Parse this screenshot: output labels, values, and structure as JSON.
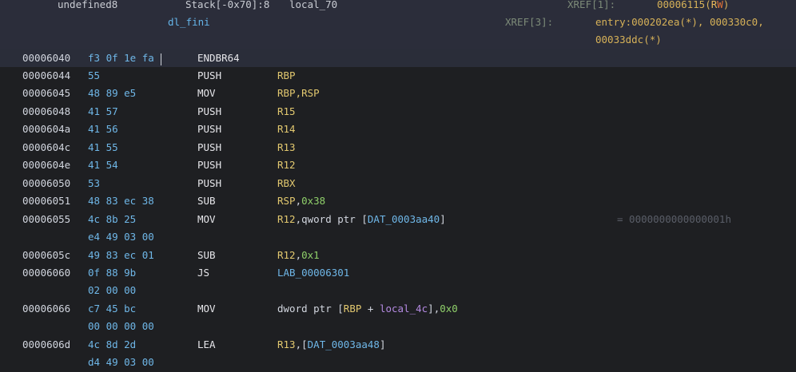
{
  "header": {
    "var_type": "undefined8",
    "var_storage": "Stack[-0x70]:8",
    "var_name": "local_70",
    "xref1_label": "XREF[1]:",
    "xref1_value": "00006115",
    "xref1_rw_r": "R",
    "xref1_rw_w": "W",
    "xref1_rw_open": "(",
    "xref1_rw_close": ")",
    "function_name": "dl_fini",
    "xref3_label": "XREF[3]:",
    "xref3_line1": "entry:000202ea(*), 000330c0,",
    "xref3_line2": "00033ddc(*)"
  },
  "listing": {
    "rows": [
      {
        "addr": "00006040",
        "b1": "f3 0f 1e fa",
        "mn": "ENDBR64"
      },
      {
        "addr": "00006044",
        "b1": "55",
        "mn": "PUSH",
        "op": "RBP"
      },
      {
        "addr": "00006045",
        "b1": "48 89 e5",
        "mn": "MOV",
        "op": "RBP,RSP"
      },
      {
        "addr": "00006048",
        "b1": "41 57",
        "mn": "PUSH",
        "op": "R15"
      },
      {
        "addr": "0000604a",
        "b1": "41 56",
        "mn": "PUSH",
        "op": "R14"
      },
      {
        "addr": "0000604c",
        "b1": "41 55",
        "mn": "PUSH",
        "op": "R13"
      },
      {
        "addr": "0000604e",
        "b1": "41 54",
        "mn": "PUSH",
        "op": "R12"
      },
      {
        "addr": "00006050",
        "b1": "53",
        "mn": "PUSH",
        "op": "RBX"
      },
      {
        "addr": "00006051",
        "b1": "48 83 ec 38",
        "mn": "SUB",
        "op_reg": "RSP",
        "op_comma": ",",
        "op_num": "0x38"
      },
      {
        "addr": "00006055",
        "b1": "4c 8b 25",
        "b2": "e4 49 03 00",
        "mn": "MOV",
        "op_reg": "R12",
        "op_mid": ",qword ptr [",
        "op_lab": "DAT_0003aa40",
        "op_end": "]",
        "comment": "= 0000000000000001h"
      },
      {
        "addr": "0000605c",
        "b1": "49 83 ec 01",
        "mn": "SUB",
        "op_reg": "R12",
        "op_comma": ",",
        "op_num": "0x1"
      },
      {
        "addr": "00006060",
        "b1": "0f 88 9b",
        "b2": "02 00 00",
        "mn": "JS",
        "op_lab": "LAB_00006301"
      },
      {
        "addr": "00006066",
        "b1": "c7 45 bc",
        "b2": "00 00 00 00",
        "mn": "MOV",
        "op_pre": "dword ptr [",
        "op_reg": "RBP",
        "op_plus": " + ",
        "op_loc": "local_4c",
        "op_post": "],",
        "op_num": "0x0"
      },
      {
        "addr": "0000606d",
        "b1": "4c 8d 2d",
        "b2": "d4 49 03 00",
        "mn": "LEA",
        "op_reg": "R13",
        "op_mid": ",[",
        "op_lab": "DAT_0003aa48",
        "op_end": "]"
      }
    ]
  }
}
